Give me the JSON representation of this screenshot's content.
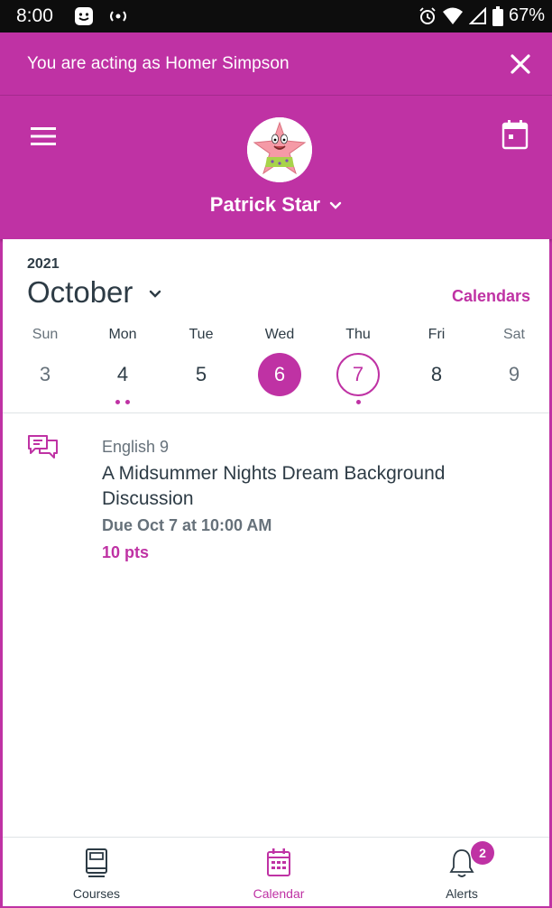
{
  "status_bar": {
    "time": "8:00",
    "battery": "67%",
    "notification_icons": [
      "messenger-icon",
      "hotspot-icon"
    ],
    "system_icons": [
      "alarm-icon",
      "wifi-icon",
      "signal-icon",
      "battery-icon"
    ]
  },
  "acting_banner": {
    "text": "You are acting as Homer Simpson",
    "close_icon": "close-icon"
  },
  "header": {
    "menu_icon": "hamburger-icon",
    "calendar_icon": "calendar-icon",
    "student_name": "Patrick Star",
    "avatar": "avatar-patrick-star"
  },
  "calendar": {
    "year": "2021",
    "month": "October",
    "calendars_link": "Calendars",
    "days": [
      {
        "dow": "Sun",
        "num": "3",
        "weekend": true,
        "state": "",
        "dots": 0
      },
      {
        "dow": "Mon",
        "num": "4",
        "weekend": false,
        "state": "",
        "dots": 2
      },
      {
        "dow": "Tue",
        "num": "5",
        "weekend": false,
        "state": "",
        "dots": 0
      },
      {
        "dow": "Wed",
        "num": "6",
        "weekend": false,
        "state": "selected",
        "dots": 0
      },
      {
        "dow": "Thu",
        "num": "7",
        "weekend": false,
        "state": "today",
        "dots": 1
      },
      {
        "dow": "Fri",
        "num": "8",
        "weekend": false,
        "state": "",
        "dots": 0
      },
      {
        "dow": "Sat",
        "num": "9",
        "weekend": true,
        "state": "",
        "dots": 0
      }
    ]
  },
  "event": {
    "icon": "discussion-icon",
    "course": "English 9",
    "title": "A Midsummer Nights Dream Background Discussion",
    "due": "Due Oct 7 at 10:00 AM",
    "points": "10 pts"
  },
  "bottom_nav": {
    "items": [
      {
        "label": "Courses",
        "icon": "courses-icon",
        "active": false
      },
      {
        "label": "Calendar",
        "icon": "calendar-icon",
        "active": true
      },
      {
        "label": "Alerts",
        "icon": "bell-icon",
        "active": false,
        "badge": "2"
      }
    ]
  },
  "colors": {
    "brand": "#bf32a4",
    "text_primary": "#2d3b45",
    "text_secondary": "#66717a"
  }
}
